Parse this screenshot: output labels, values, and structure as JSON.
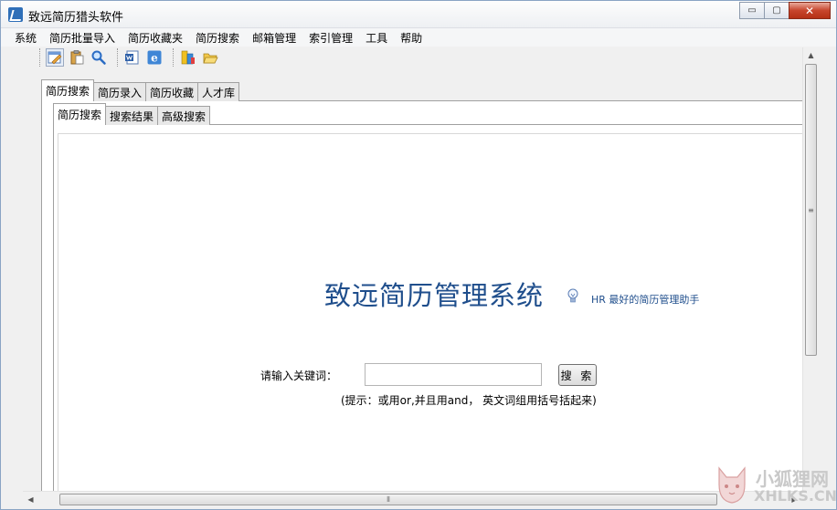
{
  "window": {
    "title": "致远简历猎头软件",
    "minimize": "▭",
    "restore": "▢",
    "close": "✕"
  },
  "menu": [
    "系统",
    "简历批量导入",
    "简历收藏夹",
    "简历搜索",
    "邮箱管理",
    "索引管理",
    "工具",
    "帮助"
  ],
  "toolbar": {
    "groups": [
      [
        "edit-icon",
        "clipboard-icon",
        "search-icon"
      ],
      [
        "word-icon",
        "ie-icon"
      ],
      [
        "colors-icon",
        "folder-icon"
      ]
    ]
  },
  "outer_tabs": [
    "简历搜索",
    "简历录入",
    "简历收藏",
    "人才库"
  ],
  "inner_tabs": [
    "简历搜索",
    "搜索结果",
    "高级搜索"
  ],
  "main": {
    "headline": "致远简历管理系统",
    "tagline": "HR 最好的简历管理助手",
    "keyword_label": "请输入关键词：",
    "keyword_value": "",
    "search_button": "搜 索",
    "hint": "(提示：或用or,并且用and， 英文词组用括号括起来)"
  },
  "watermark": {
    "cn": "小狐狸网",
    "en": "XHLKS.CN"
  }
}
